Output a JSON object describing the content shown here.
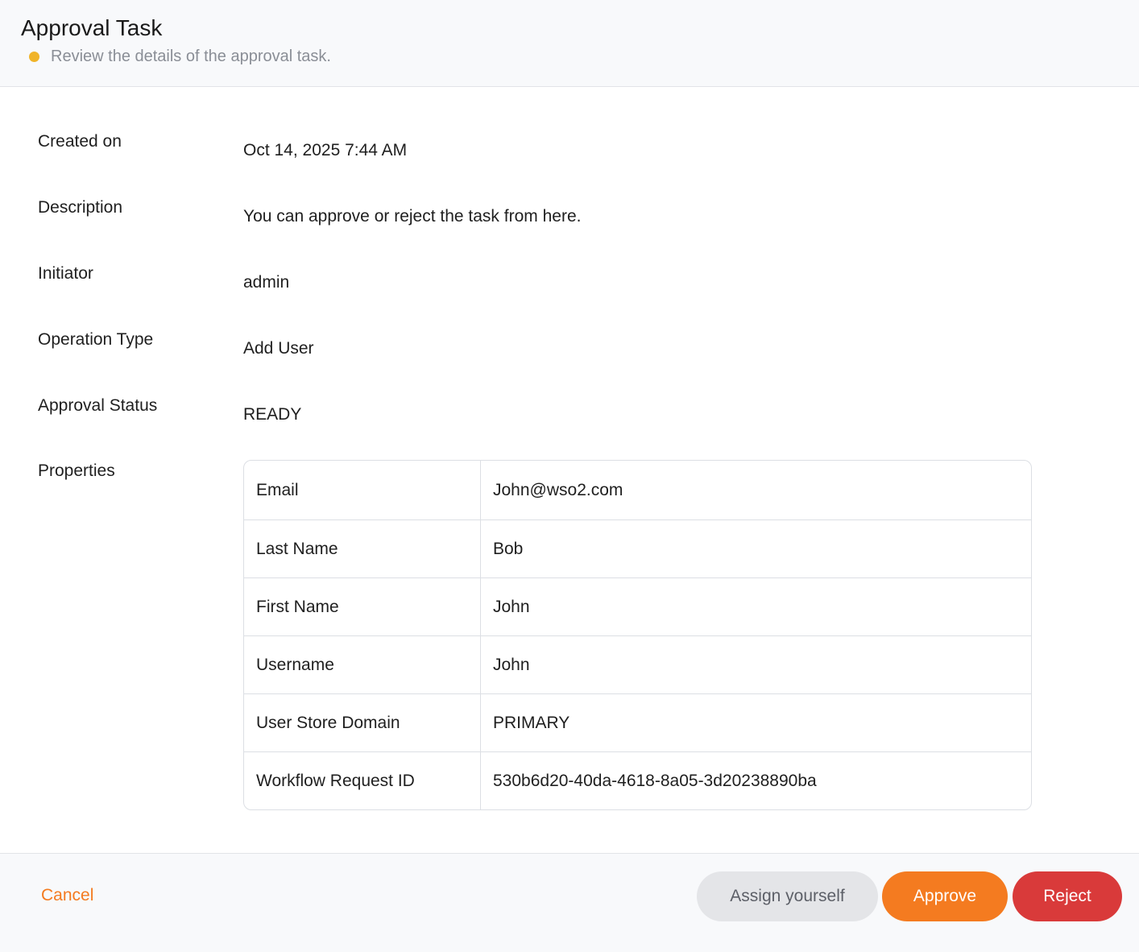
{
  "header": {
    "title": "Approval Task",
    "subtitle": "Review the details of the approval task.",
    "status_dot_color": "#f0b429"
  },
  "details": {
    "created_on": {
      "label": "Created on",
      "value": "Oct 14, 2025 7:44 AM"
    },
    "description": {
      "label": "Description",
      "value": "You can approve or reject the task from here."
    },
    "initiator": {
      "label": "Initiator",
      "value": "admin"
    },
    "operation_type": {
      "label": "Operation Type",
      "value": "Add User"
    },
    "approval_status": {
      "label": "Approval Status",
      "value": "READY"
    },
    "properties_label": "Properties"
  },
  "properties": [
    {
      "key": "Email",
      "value": "John@wso2.com"
    },
    {
      "key": "Last Name",
      "value": "Bob"
    },
    {
      "key": "First Name",
      "value": "John"
    },
    {
      "key": "Username",
      "value": "John"
    },
    {
      "key": "User Store Domain",
      "value": "PRIMARY"
    },
    {
      "key": "Workflow Request ID",
      "value": "530b6d20-40da-4618-8a05-3d20238890ba"
    }
  ],
  "footer": {
    "cancel_label": "Cancel",
    "assign_label": "Assign yourself",
    "approve_label": "Approve",
    "reject_label": "Reject"
  },
  "colors": {
    "accent": "#f47b20",
    "reject": "#d93a3a",
    "neutral_button": "#e4e5e8"
  }
}
